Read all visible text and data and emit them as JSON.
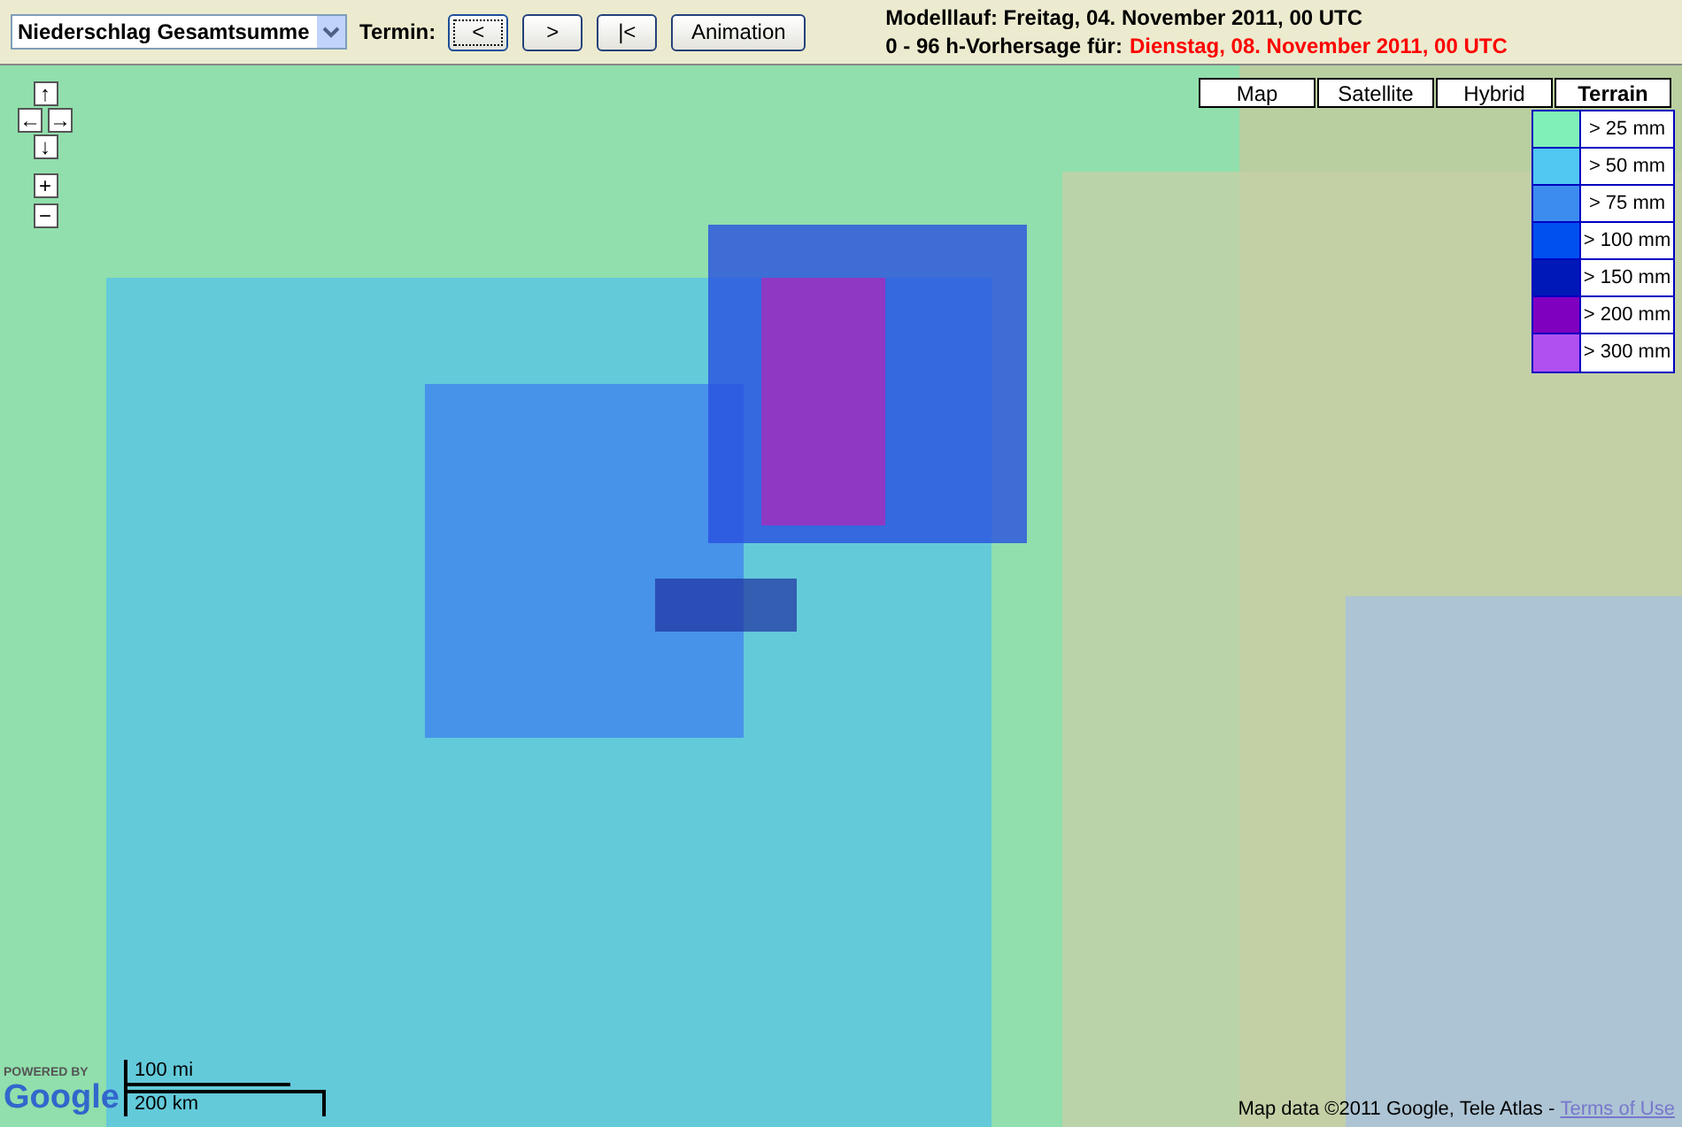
{
  "toolbar": {
    "product_select": "Niederschlag Gesamtsumme",
    "termin_label": "Termin:",
    "buttons": [
      {
        "label": "<",
        "selected": true
      },
      {
        "label": ">",
        "selected": false
      },
      {
        "label": "|<",
        "selected": false
      },
      {
        "label": "Animation",
        "selected": false
      }
    ],
    "model_run": "Modelllauf: Freitag, 04. November 2011, 00 UTC",
    "forecast_label": "0 - 96 h-Vorhersage für:",
    "forecast_time": "Dienstag, 08. November 2011, 00 UTC"
  },
  "map": {
    "nav_buttons": [
      {
        "label": "↑",
        "kind": "pan"
      },
      {
        "label": "←",
        "kind": "pan"
      },
      {
        "label": "→",
        "kind": "pan"
      },
      {
        "label": "↓",
        "kind": "pan"
      },
      {
        "label": "+",
        "kind": "zoom"
      },
      {
        "label": "−",
        "kind": "zoom"
      }
    ],
    "map_types": [
      {
        "label": "Map",
        "selected": false
      },
      {
        "label": "Satellite",
        "selected": false
      },
      {
        "label": "Hybrid",
        "selected": false
      },
      {
        "label": "Terrain",
        "selected": true
      }
    ],
    "legend": [
      {
        "label": "> 25 mm",
        "color": "#80f0b8"
      },
      {
        "label": "> 50 mm",
        "color": "#50c8f0"
      },
      {
        "label": "> 75 mm",
        "color": "#3c8cf0"
      },
      {
        "label": "> 100 mm",
        "color": "#0050f0"
      },
      {
        "label": "> 150 mm",
        "color": "#0018b8"
      },
      {
        "label": "> 200 mm",
        "color": "#8000c0"
      },
      {
        "label": "> 300 mm",
        "color": "#b050f0"
      }
    ],
    "powered_by": "POWERED BY",
    "logo": "Google",
    "scale": [
      "100 mi",
      "200 km"
    ],
    "attribution": "Map data ©2011 Google, Tele Atlas - ",
    "terms_link": "Terms of Use"
  }
}
